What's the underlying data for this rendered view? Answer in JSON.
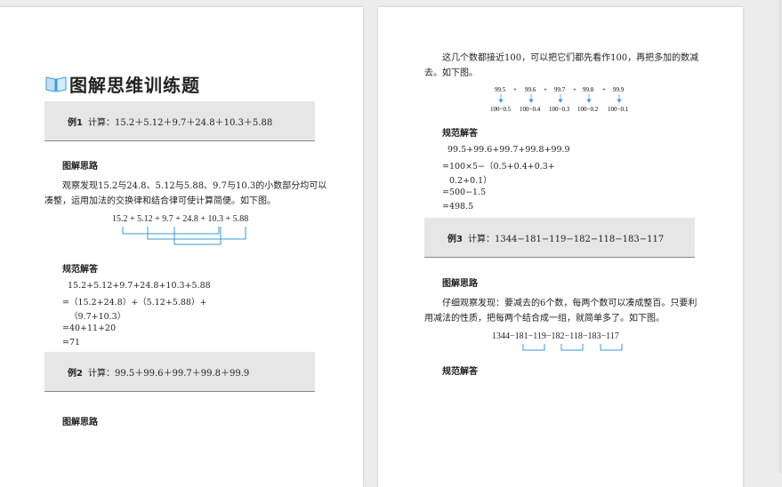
{
  "left_page": {
    "title": "图解思维训练题",
    "example1": {
      "label": "例1",
      "text": "计算：15.2＋5.12＋9.7＋24.8＋10.3＋5.88"
    },
    "ex1_thinking_head": "图解思路",
    "ex1_thinking_lines": [
      "观察发现15.2与24.8、5.12与5.88、9.7与10.3的小数部分均可以",
      "凑整，运用加法的交换律和结合律可使计算简便。如下图。"
    ],
    "ex1_diagram_expr": "15.2 + 5.12 + 9.7 + 24.8 + 10.3 + 5.88",
    "ex1_solution_head": "规范解答",
    "ex1_solution_lines": [
      "15.2+5.12+9.7+24.8+10.3+5.88",
      "=（15.2+24.8）+（5.12+5.88）+",
      "（9.7+10.3）",
      "=40+11+20",
      "=71"
    ],
    "example2": {
      "label": "例2",
      "text": "计算：99.5＋99.6＋99.7＋99.8＋99.9"
    },
    "ex2_thinking_head": "图解思路"
  },
  "right_page": {
    "intro_lines": [
      "这几个数都接近100，可以把它们都先看作100，再把多加的数减",
      "去。如下图。"
    ],
    "ex2_diagram": {
      "top": [
        "99.5",
        "+",
        "99.6",
        "+",
        "99.7",
        "+",
        "99.8",
        "+",
        "99.9"
      ],
      "bottom": [
        "100−0.5",
        "100−0.4",
        "100−0.3",
        "100−0.2",
        "100−0.1"
      ]
    },
    "ex2_solution_head": "规范解答",
    "ex2_solution_lines": [
      "99.5+99.6+99.7+99.8+99.9",
      "=100×5−（0.5+0.4+0.3+",
      "0.2+0.1）",
      "=500−1.5",
      "=498.5"
    ],
    "example3": {
      "label": "例3",
      "text": "计算：1344−181−119−182−118−183−117"
    },
    "ex3_thinking_head": "图解思路",
    "ex3_thinking_lines": [
      "仔细观察发现：要减去的6个数，每两个数可以凑成整百。只要利",
      "用减法的性质，把每两个结合成一组，就简单多了。如下图。"
    ],
    "ex3_diagram_expr": "1344−181−119−182−118−183−117",
    "ex3_solution_head": "规范解答"
  },
  "colors": {
    "accent_blue": "#3a9ad9",
    "box_gray": "#e6e6e6",
    "background": "#ececec"
  }
}
